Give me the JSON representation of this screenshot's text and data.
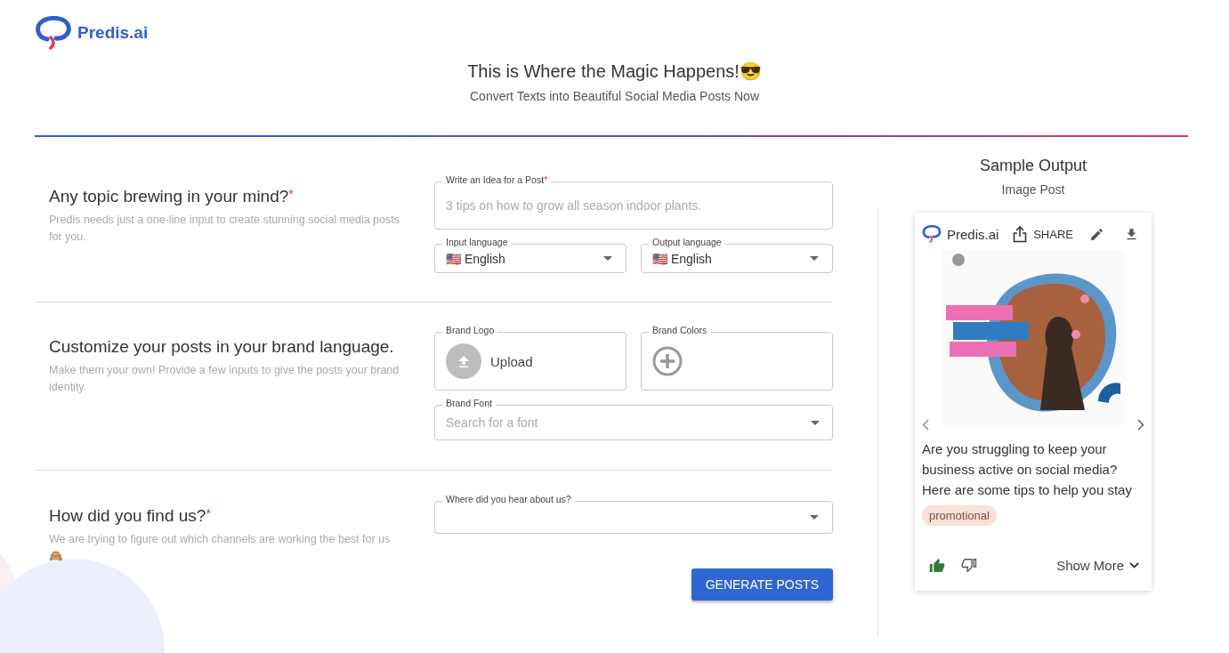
{
  "logo": {
    "text": "Predis.ai"
  },
  "hero": {
    "title": "This is Where the Magic Happens!😎",
    "subtitle": "Convert Texts into Beautiful Social Media Posts Now"
  },
  "sections": [
    {
      "title": "Any topic brewing in your mind?",
      "required_mark": "*",
      "description": "Predis needs just a one-line input to create stunning social media posts for you.",
      "rows": [
        [
          {
            "kind": "text",
            "label": "Write an Idea for a Post",
            "required_mark": "*",
            "placeholder": "3 tips on how to grow all season indoor plants."
          }
        ],
        [
          {
            "kind": "select",
            "label": "Input language",
            "value": "🇺🇸 English"
          },
          {
            "kind": "select",
            "label": "Output language",
            "value": "🇺🇸 English"
          }
        ]
      ]
    },
    {
      "title": "Customize your posts in your brand language.",
      "description": "Make them your own! Provide a few inputs to give the posts your brand identity.",
      "rows": [
        [
          {
            "kind": "upload",
            "label": "Brand Logo",
            "button": "Upload"
          },
          {
            "kind": "colors",
            "label": "Brand Colors"
          }
        ],
        [
          {
            "kind": "autocomplete",
            "label": "Brand Font",
            "placeholder": "Search for a font"
          }
        ]
      ]
    },
    {
      "title": "How did you find us?",
      "required_mark": "*",
      "description": "We are trying to figure out which channels are working the best for us 🙈",
      "rows": [
        [
          {
            "kind": "select",
            "label": "Where did you hear about us?"
          }
        ]
      ]
    }
  ],
  "generate_button": "GENERATE POSTS",
  "sample": {
    "title": "Sample Output",
    "subtitle": "Image Post",
    "card": {
      "brand": "Predis.ai",
      "share": "SHARE",
      "caption": "Are you struggling to keep your business active on social media? Here are some tips to help you stay",
      "tag": "promotional",
      "liked": true,
      "disliked": false,
      "show_more": "Show More"
    }
  }
}
